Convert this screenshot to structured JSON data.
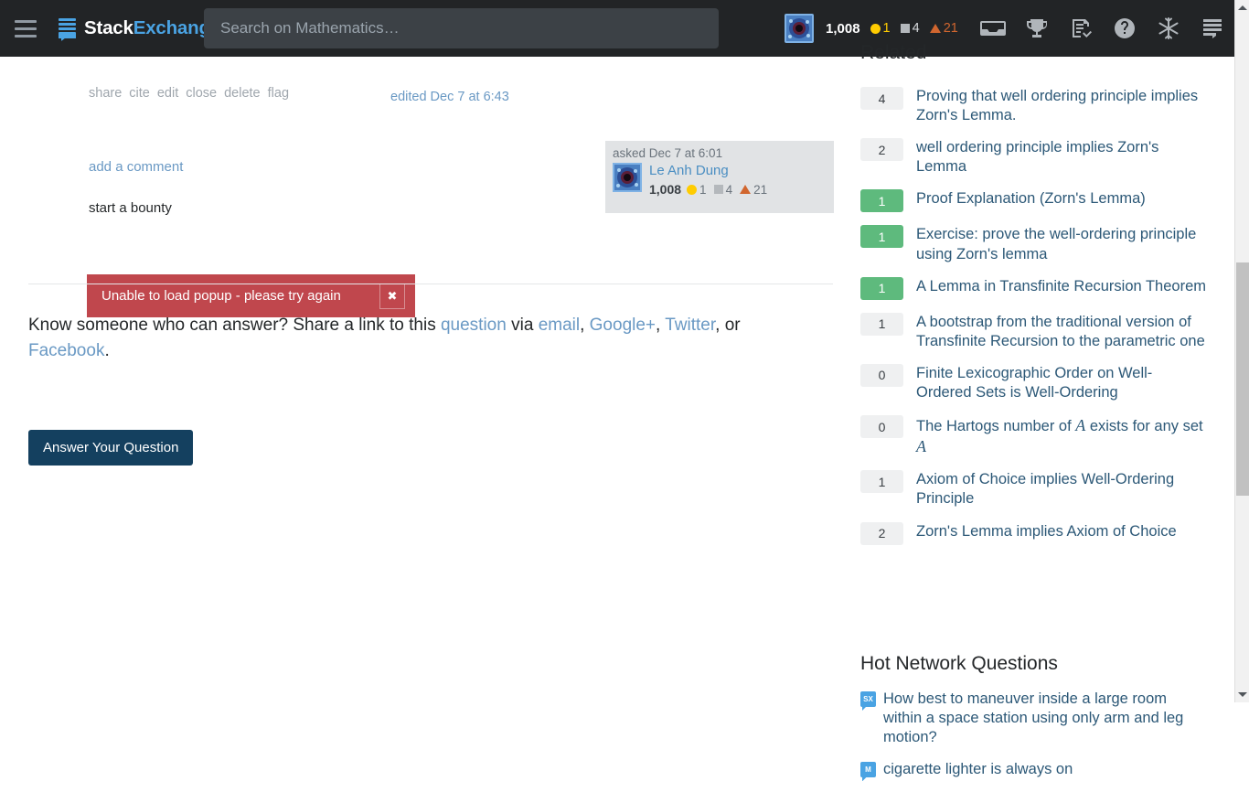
{
  "topbar": {
    "hamburger_icon": "hamburger-menu-icon",
    "logo": {
      "icon": "stackexchange-logo-icon",
      "word1": "Stack",
      "word2": "Exchange"
    },
    "search": {
      "placeholder": "Search on Mathematics…",
      "value": ""
    },
    "user": {
      "avatar_icon": "user-avatar",
      "reputation": "1,008",
      "gold_count": "1",
      "silver_count": "4",
      "bronze_count": "21"
    },
    "nav_icons": [
      {
        "name": "inbox-icon",
        "label": "Inbox"
      },
      {
        "name": "trophy-icon",
        "label": "Achievements"
      },
      {
        "name": "review-icon",
        "label": "Review"
      },
      {
        "name": "help-icon",
        "label": "Help"
      },
      {
        "name": "snowflake-icon",
        "label": "Winter Bash"
      },
      {
        "name": "site-switcher-icon",
        "label": "Site Switcher"
      }
    ]
  },
  "post": {
    "menu": [
      "share",
      "cite",
      "edit",
      "close",
      "delete",
      "flag"
    ],
    "edited": "edited Dec 7 at 6:43",
    "usercard": {
      "action_time": "asked Dec 7 at 6:01",
      "avatar_icon": "asker-avatar",
      "username": "Le Anh Dung",
      "reputation": "1,008",
      "gold_count": "1",
      "silver_count": "4",
      "bronze_count": "21"
    },
    "add_comment": "add a comment",
    "start_bounty": "start a bounty"
  },
  "error": {
    "message": "Unable to load popup - please try again",
    "close_icon": "close-icon",
    "close_label": "✖",
    "color": "#c0474d"
  },
  "share": {
    "prefix": "Know someone who can answer? Share a link to this ",
    "question_link": "question",
    "via": " via ",
    "email_link": "email",
    "sep1": ", ",
    "googleplus_link": "Google+",
    "sep2": ", ",
    "twitter_link": "Twitter",
    "sep3": ", or ",
    "facebook_link": "Facebook",
    "suffix": ".",
    "answer_button": "Answer Your Question",
    "answer_button_color": "#14405f"
  },
  "sidebar": {
    "related_title": "Related",
    "related": [
      {
        "score": "4",
        "score_style": "gray",
        "title": "Proving that well ordering principle implies Zorn's Lemma."
      },
      {
        "score": "2",
        "score_style": "gray",
        "title": "well ordering principle implies Zorn's Lemma"
      },
      {
        "score": "1",
        "score_style": "green",
        "title": "Proof Explanation (Zorn's Lemma)"
      },
      {
        "score": "1",
        "score_style": "green",
        "title": "Exercise: prove the well-ordering principle using Zorn's lemma"
      },
      {
        "score": "1",
        "score_style": "green",
        "title": "A Lemma in Transfinite Recursion Theorem"
      },
      {
        "score": "1",
        "score_style": "gray",
        "title": "A bootstrap from the traditional version of Transfinite Recursion to the parametric one"
      },
      {
        "score": "0",
        "score_style": "gray",
        "title": "Finite Lexicographic Order on Well-Ordered Sets is Well-Ordering"
      },
      {
        "score": "0",
        "score_style": "gray",
        "title": "The Hartogs number of A exists for any set A",
        "math_tokens": [
          "A"
        ]
      },
      {
        "score": "1",
        "score_style": "gray",
        "title": "Axiom of Choice implies Well-Ordering Principle"
      },
      {
        "score": "2",
        "score_style": "gray",
        "title": "Zorn's Lemma implies Axiom of Choice"
      }
    ],
    "hot_title": "Hot Network Questions",
    "hot": [
      {
        "site_icon": "space-exchange-favicon",
        "site_abbr": "SX",
        "title": "How best to maneuver inside a large room within a space station using only arm and leg motion?"
      },
      {
        "site_icon": "movies-exchange-favicon",
        "site_abbr": "M",
        "title": "cigarette lighter is always on"
      }
    ]
  },
  "scrollbar": {
    "up_icon": "scroll-up-arrow-icon",
    "down_icon": "scroll-down-arrow-icon",
    "thumb_name": "scrollbar-thumb"
  }
}
